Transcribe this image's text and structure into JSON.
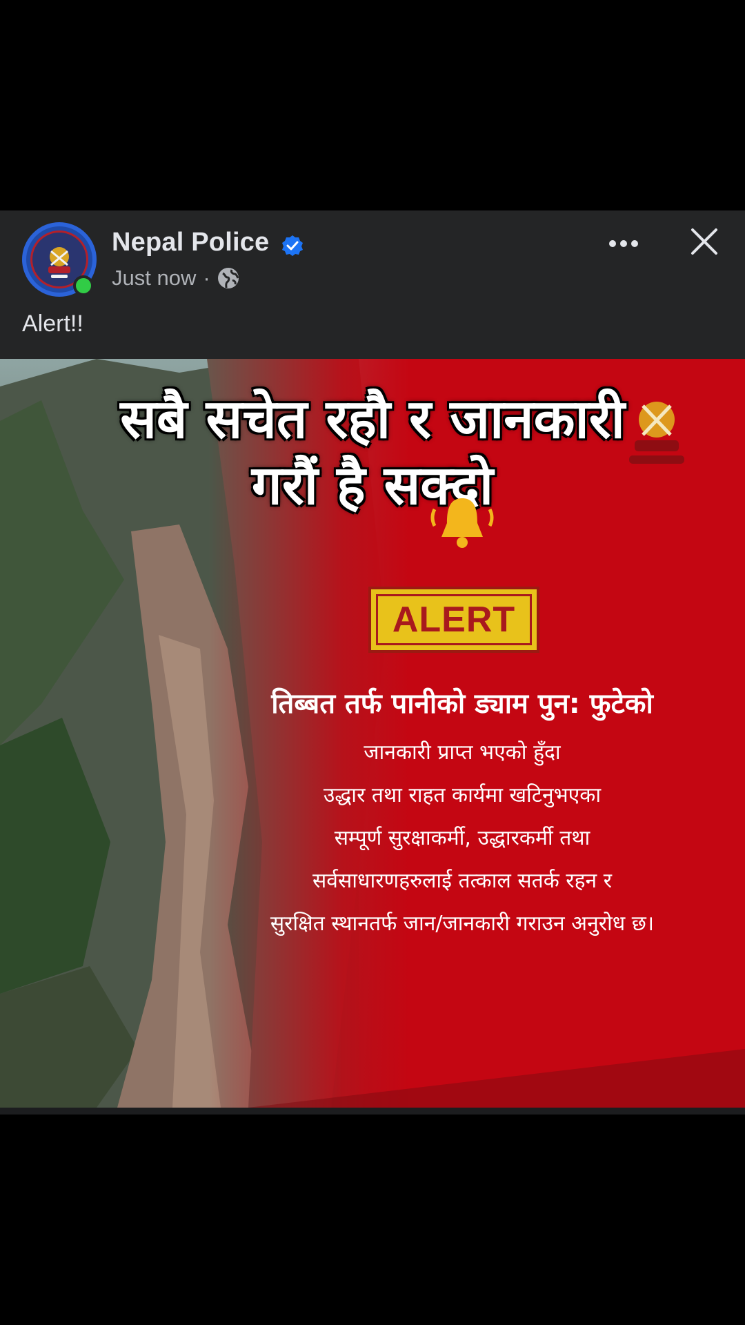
{
  "post": {
    "page_name": "Nepal Police",
    "verified": true,
    "timestamp": "Just now",
    "separator": "·",
    "audience_icon": "globe-icon",
    "caption": "Alert!!",
    "more_icon": "more-horizontal-icon",
    "close_icon": "close-icon",
    "online_status_color": "#31cc46"
  },
  "image": {
    "overlay_title_line1": "सबै सचेत रहौ र जानकारी",
    "overlay_title_line2": "गरौं है सक्दो",
    "alert_badge": "ALERT",
    "notice_headline": "तिब्बत तर्फ पानीको ड्याम पुन: फुटेको",
    "notice_lines": [
      "जानकारी प्राप्त भएको हुँदा",
      "उद्धार तथा राहत कार्यमा खटिनुभएका",
      "सम्पूर्ण सुरक्षाकर्मी, उद्धारकर्मी तथा",
      "सर्वसाधारणहरुलाई तत्काल सतर्क रहन र",
      "सुरक्षित स्थानतर्फ जान/जानकारी गराउन अनुरोध छ।"
    ],
    "accent_red": "#c40612",
    "badge_yellow": "#e8c21b"
  }
}
